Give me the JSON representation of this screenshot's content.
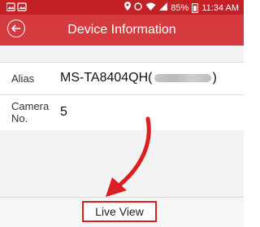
{
  "status_bar": {
    "battery_percent": "85%",
    "time": "11:34 AM"
  },
  "header": {
    "title": "Device Information"
  },
  "fields": [
    {
      "label": "Alias",
      "value_prefix": "MS-TA8404QH(",
      "value_suffix": ")"
    },
    {
      "label_line1": "Camera",
      "label_line2": "No.",
      "value": "5"
    }
  ],
  "footer": {
    "live_view_label": "Live View"
  },
  "colors": {
    "header": "#d53a3e",
    "status_bar": "#c42127",
    "highlight": "#d92020"
  }
}
